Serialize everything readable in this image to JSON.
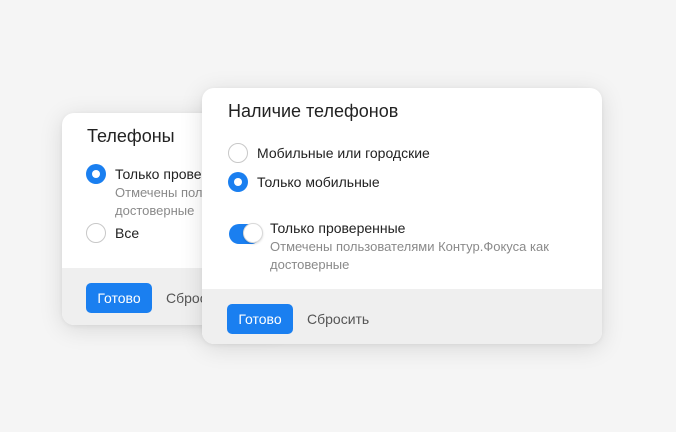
{
  "back_card": {
    "title": "Телефоны",
    "options": [
      {
        "label": "Только провер",
        "description_line1": "Отмечены поль",
        "description_line2": "достоверные",
        "selected": true
      },
      {
        "label": "Все",
        "selected": false
      }
    ],
    "done_label": "Готово",
    "reset_label": "Сброс"
  },
  "front_card": {
    "title": "Наличие телефонов",
    "options": [
      {
        "label": "Мобильные или городские",
        "selected": false
      },
      {
        "label": "Только мобильные",
        "selected": true
      }
    ],
    "toggle": {
      "on": true,
      "label": "Только проверенные",
      "description_line1": "Отмечены пользователями Контур.Фокуса как",
      "description_line2": "достоверные"
    },
    "done_label": "Готово",
    "reset_label": "Сбросить"
  },
  "colors": {
    "accent": "#1a7ff0",
    "background": "#f5f5f5",
    "footer": "#efefef"
  }
}
